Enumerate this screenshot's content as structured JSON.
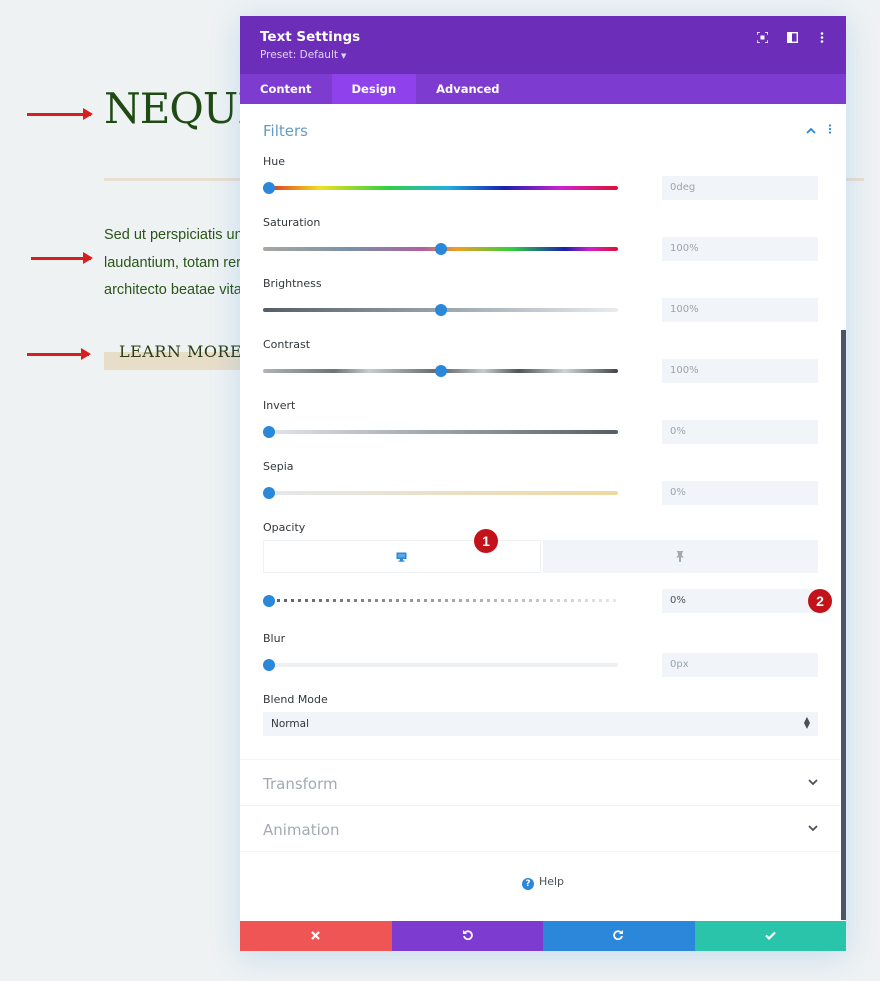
{
  "background": {
    "title": "NEQUE",
    "body_lines": [
      "Sed ut perspiciatis unc",
      "laudantium, totam rer",
      "architecto beatae vita"
    ],
    "button_label": "LEARN MORE"
  },
  "panel": {
    "title": "Text Settings",
    "preset": "Preset: Default",
    "header_icons": [
      "focus-icon",
      "split-view-icon",
      "more-vertical-icon"
    ],
    "tabs": [
      {
        "label": "Content",
        "active": false
      },
      {
        "label": "Design",
        "active": true
      },
      {
        "label": "Advanced",
        "active": false
      }
    ],
    "filters": {
      "title": "Filters",
      "fields": [
        {
          "label": "Hue",
          "value": "0deg",
          "position": 0
        },
        {
          "label": "Saturation",
          "value": "100%",
          "position": 0.5
        },
        {
          "label": "Brightness",
          "value": "100%",
          "position": 0.5
        },
        {
          "label": "Contrast",
          "value": "100%",
          "position": 0.5
        },
        {
          "label": "Invert",
          "value": "0%",
          "position": 0
        },
        {
          "label": "Sepia",
          "value": "0%",
          "position": 0
        }
      ],
      "opacity": {
        "label": "Opacity",
        "value": "0%",
        "position": 0,
        "device_tabs": [
          "desktop-icon",
          "pin-icon"
        ]
      },
      "blur": {
        "label": "Blur",
        "value": "0px",
        "position": 0
      },
      "blend_mode": {
        "label": "Blend Mode",
        "value": "Normal"
      }
    },
    "collapsed_sections": [
      "Transform",
      "Animation"
    ],
    "help_label": "Help",
    "annotations": [
      "1",
      "2"
    ],
    "footer": {
      "colors": {
        "cancel": "#ef5555",
        "undo": "#7e3bd0",
        "redo": "#2b87da",
        "save": "#29c4a9"
      }
    }
  }
}
